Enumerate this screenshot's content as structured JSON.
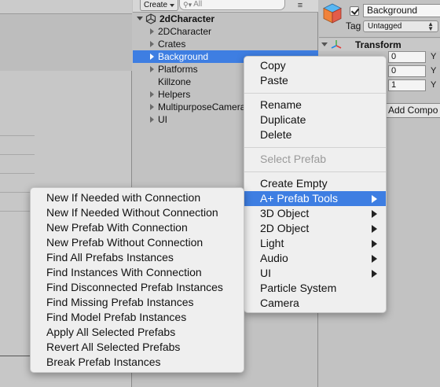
{
  "hierarchy": {
    "create_label": "Create",
    "search_placeholder": "All",
    "root": "2dCharacter",
    "children": [
      {
        "label": "2DCharacter",
        "has_children": true,
        "selected": false
      },
      {
        "label": "Crates",
        "has_children": true,
        "selected": false
      },
      {
        "label": "Background",
        "has_children": true,
        "selected": true
      },
      {
        "label": "Platforms",
        "has_children": true,
        "selected": false
      },
      {
        "label": "Killzone",
        "has_children": false,
        "selected": false
      },
      {
        "label": "Helpers",
        "has_children": true,
        "selected": false
      },
      {
        "label": "MultipurposeCamera",
        "has_children": true,
        "selected": false
      },
      {
        "label": "UI",
        "has_children": true,
        "selected": false
      }
    ]
  },
  "inspector": {
    "object_name": "Background",
    "active": true,
    "tag_label": "Tag",
    "tag_value": "Untagged",
    "transform_title": "Transform",
    "fields": [
      {
        "value": "0",
        "axis": "Y"
      },
      {
        "value": "0",
        "axis": "Y"
      },
      {
        "value": "1",
        "axis": "Y"
      }
    ],
    "add_component_label": "Add Compo"
  },
  "context_menu": {
    "groups": [
      [
        {
          "label": "Copy"
        },
        {
          "label": "Paste"
        }
      ],
      [
        {
          "label": "Rename"
        },
        {
          "label": "Duplicate"
        },
        {
          "label": "Delete"
        }
      ],
      [
        {
          "label": "Select Prefab",
          "disabled": true
        }
      ],
      [
        {
          "label": "Create Empty"
        },
        {
          "label": "A+ Prefab Tools",
          "submenu": true,
          "highlighted": true
        },
        {
          "label": "3D Object",
          "submenu": true
        },
        {
          "label": "2D Object",
          "submenu": true
        },
        {
          "label": "Light",
          "submenu": true
        },
        {
          "label": "Audio",
          "submenu": true
        },
        {
          "label": "UI",
          "submenu": true
        },
        {
          "label": "Particle System"
        },
        {
          "label": "Camera"
        }
      ]
    ]
  },
  "prefab_submenu": {
    "items": [
      "New If Needed with Connection",
      "New If Needed Without Connection",
      "New Prefab With Connection",
      "New Prefab Without Connection",
      "Find All Prefabs Instances",
      "Find Instances With Connection",
      "Find Disconnected Prefab Instances",
      "Find Missing Prefab Instances",
      "Find Model Prefab Instances",
      "Apply All Selected Prefabs",
      "Revert All Selected Prefabs",
      "Break Prefab Instances"
    ]
  },
  "colors": {
    "selection": "#3e7ee2",
    "panel": "#c2c2c2",
    "menu_bg": "#efefef"
  }
}
